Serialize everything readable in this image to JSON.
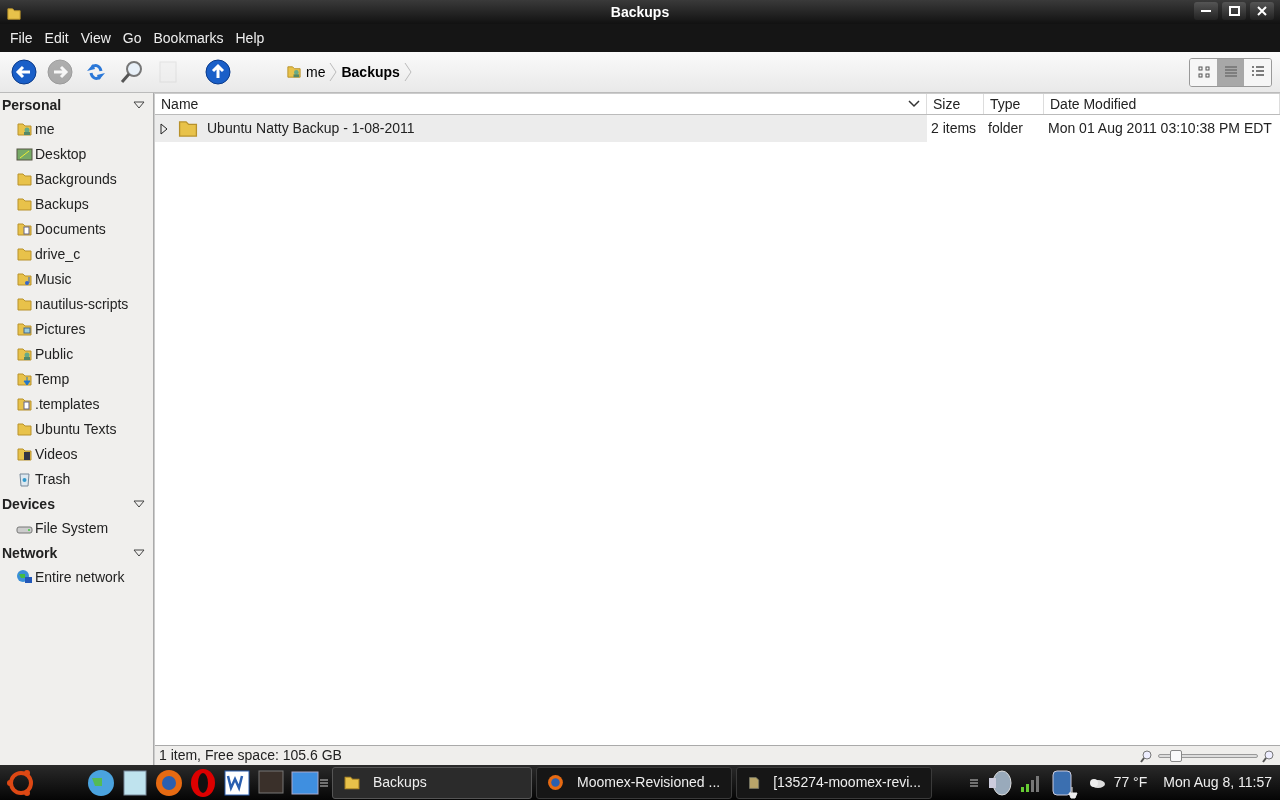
{
  "window": {
    "title": "Backups"
  },
  "menu": [
    "File",
    "Edit",
    "View",
    "Go",
    "Bookmarks",
    "Help"
  ],
  "toolbar": [
    {
      "kind": "back",
      "disabled": false
    },
    {
      "kind": "forward",
      "disabled": true
    },
    {
      "kind": "reload",
      "disabled": false
    },
    {
      "kind": "search",
      "disabled": false
    },
    {
      "kind": "page",
      "disabled": true
    },
    {
      "kind": "up",
      "disabled": false
    }
  ],
  "breadcrumb": [
    {
      "label": "me",
      "kind": "home",
      "selected": false
    },
    {
      "label": "Backups",
      "selected": true
    }
  ],
  "view_modes": [
    {
      "kind": "icons",
      "selected": false
    },
    {
      "kind": "list",
      "selected": true
    },
    {
      "kind": "compact",
      "selected": false
    }
  ],
  "sidebar": {
    "sections": [
      {
        "title": "Personal",
        "expanded": true,
        "items": [
          {
            "label": "me",
            "kind": "home"
          },
          {
            "label": "Desktop",
            "kind": "desktop"
          },
          {
            "label": "Backgrounds",
            "kind": "folder"
          },
          {
            "label": "Backups",
            "kind": "folder"
          },
          {
            "label": "Documents",
            "kind": "documents"
          },
          {
            "label": "drive_c",
            "kind": "folder"
          },
          {
            "label": "Music",
            "kind": "music"
          },
          {
            "label": "nautilus-scripts",
            "kind": "folder"
          },
          {
            "label": "Pictures",
            "kind": "pictures"
          },
          {
            "label": "Public",
            "kind": "home"
          },
          {
            "label": "Temp",
            "kind": "download"
          },
          {
            "label": ".templates",
            "kind": "documents"
          },
          {
            "label": "Ubuntu Texts",
            "kind": "folder"
          },
          {
            "label": "Videos",
            "kind": "videos"
          },
          {
            "label": "Trash",
            "kind": "trash"
          }
        ]
      },
      {
        "title": "Devices",
        "expanded": true,
        "items": [
          {
            "label": "File System",
            "kind": "drive"
          }
        ]
      },
      {
        "title": "Network",
        "expanded": true,
        "items": [
          {
            "label": "Entire network",
            "kind": "network"
          }
        ]
      }
    ]
  },
  "table": {
    "columns": [
      "Name",
      "Size",
      "Type",
      "Date Modified"
    ],
    "rows": [
      {
        "name": "Ubuntu Natty Backup - 1-08-2011",
        "size": "2 items",
        "type": "folder",
        "date": "Mon 01 Aug 2011 03:10:38 PM EDT",
        "expanded": false,
        "selected": true
      }
    ]
  },
  "status_bar": {
    "text": "1 item, Free space: 105.6 GB",
    "zoom": {
      "level": 0.17
    }
  },
  "taskbar": {
    "launchers": [
      {
        "kind": "globe"
      },
      {
        "kind": "notepad"
      },
      {
        "kind": "firefox"
      },
      {
        "kind": "opera"
      },
      {
        "kind": "word"
      },
      {
        "kind": "monitor"
      },
      {
        "kind": "desktop"
      }
    ],
    "windows": [
      {
        "label": "Backups",
        "kind": "folder",
        "selected": true
      },
      {
        "label": "Moomex-Revisioned ...",
        "kind": "firefox",
        "selected": false
      },
      {
        "label": "[135274-moomex-revi...",
        "kind": "file",
        "selected": false
      }
    ],
    "weather": "77 °F",
    "clock": "Mon Aug 8, 11:57"
  }
}
